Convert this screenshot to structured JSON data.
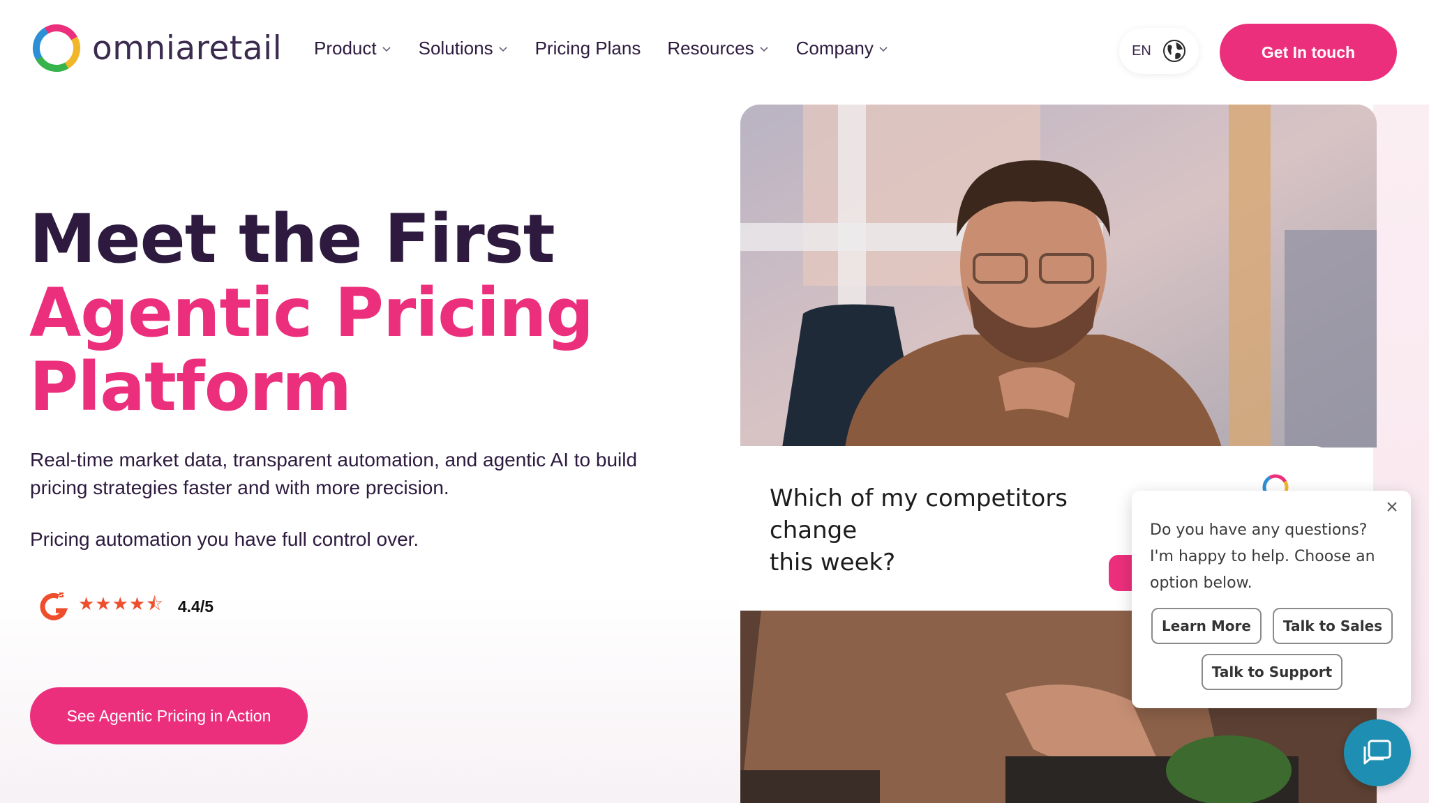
{
  "brand": {
    "name": "omniaretail",
    "accent": "#ec2f7c",
    "dark": "#2d1a3e"
  },
  "nav": {
    "items": [
      {
        "label": "Product",
        "has_dropdown": true
      },
      {
        "label": "Solutions",
        "has_dropdown": true
      },
      {
        "label": "Pricing Plans",
        "has_dropdown": false
      },
      {
        "label": "Resources",
        "has_dropdown": true
      },
      {
        "label": "Company",
        "has_dropdown": true
      }
    ],
    "language": "EN",
    "language_icon": "globe-icon",
    "cta": "Get In touch"
  },
  "hero": {
    "title_line1": "Meet the First",
    "title_line2": "Agentic Pricing",
    "title_line3": "Platform",
    "subtitle": "Real-time market data, transparent automation, and agentic AI to build pricing strategies faster and with more precision.",
    "subtitle2": "Pricing automation you have full control over.",
    "rating": {
      "icon": "g2-logo-icon",
      "stars": "★★★★⯪",
      "value": "4.4/5"
    },
    "cta": "See Agentic Pricing in Action"
  },
  "media": {
    "question": "Which of my competitors change\nthis week?"
  },
  "chat_widget": {
    "message": "Do you have any questions? I'm happy to help. Choose an option below.",
    "buttons": [
      "Learn More",
      "Talk to Sales",
      "Talk to Support"
    ],
    "fab_icon": "chat-bubbles-icon",
    "fab_color": "#1e8fb2"
  }
}
